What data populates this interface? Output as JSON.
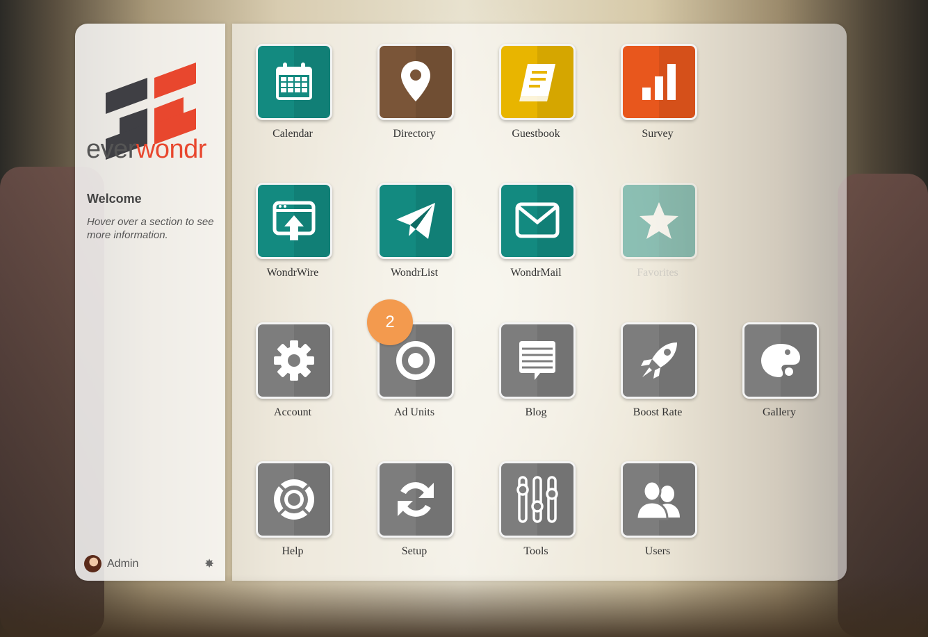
{
  "brand": {
    "logo_text_ever": "ever",
    "logo_text_wondr": "wondr"
  },
  "sidebar": {
    "welcome_title": "Welcome",
    "hint": "Hover over a section to see more information.",
    "user_name": "Admin"
  },
  "badge": {
    "value": "2"
  },
  "tiles": {
    "calendar": "Calendar",
    "directory": "Directory",
    "guestbook": "Guestbook",
    "survey": "Survey",
    "wondrwire": "WondrWire",
    "wondrlist": "WondrList",
    "wondrmail": "WondrMail",
    "favorites": "Favorites",
    "account": "Account",
    "ad_units": "Ad Units",
    "blog": "Blog",
    "boost_rate": "Boost Rate",
    "gallery": "Gallery",
    "help": "Help",
    "setup": "Setup",
    "tools": "Tools",
    "users": "Users"
  },
  "colors": {
    "teal": "#138a80",
    "brown": "#7a5538",
    "yellow": "#e8b500",
    "orange": "#e8571d",
    "gray": "#7d7d7d",
    "badge": "#f39a4e",
    "brand_red": "#e8472e"
  }
}
